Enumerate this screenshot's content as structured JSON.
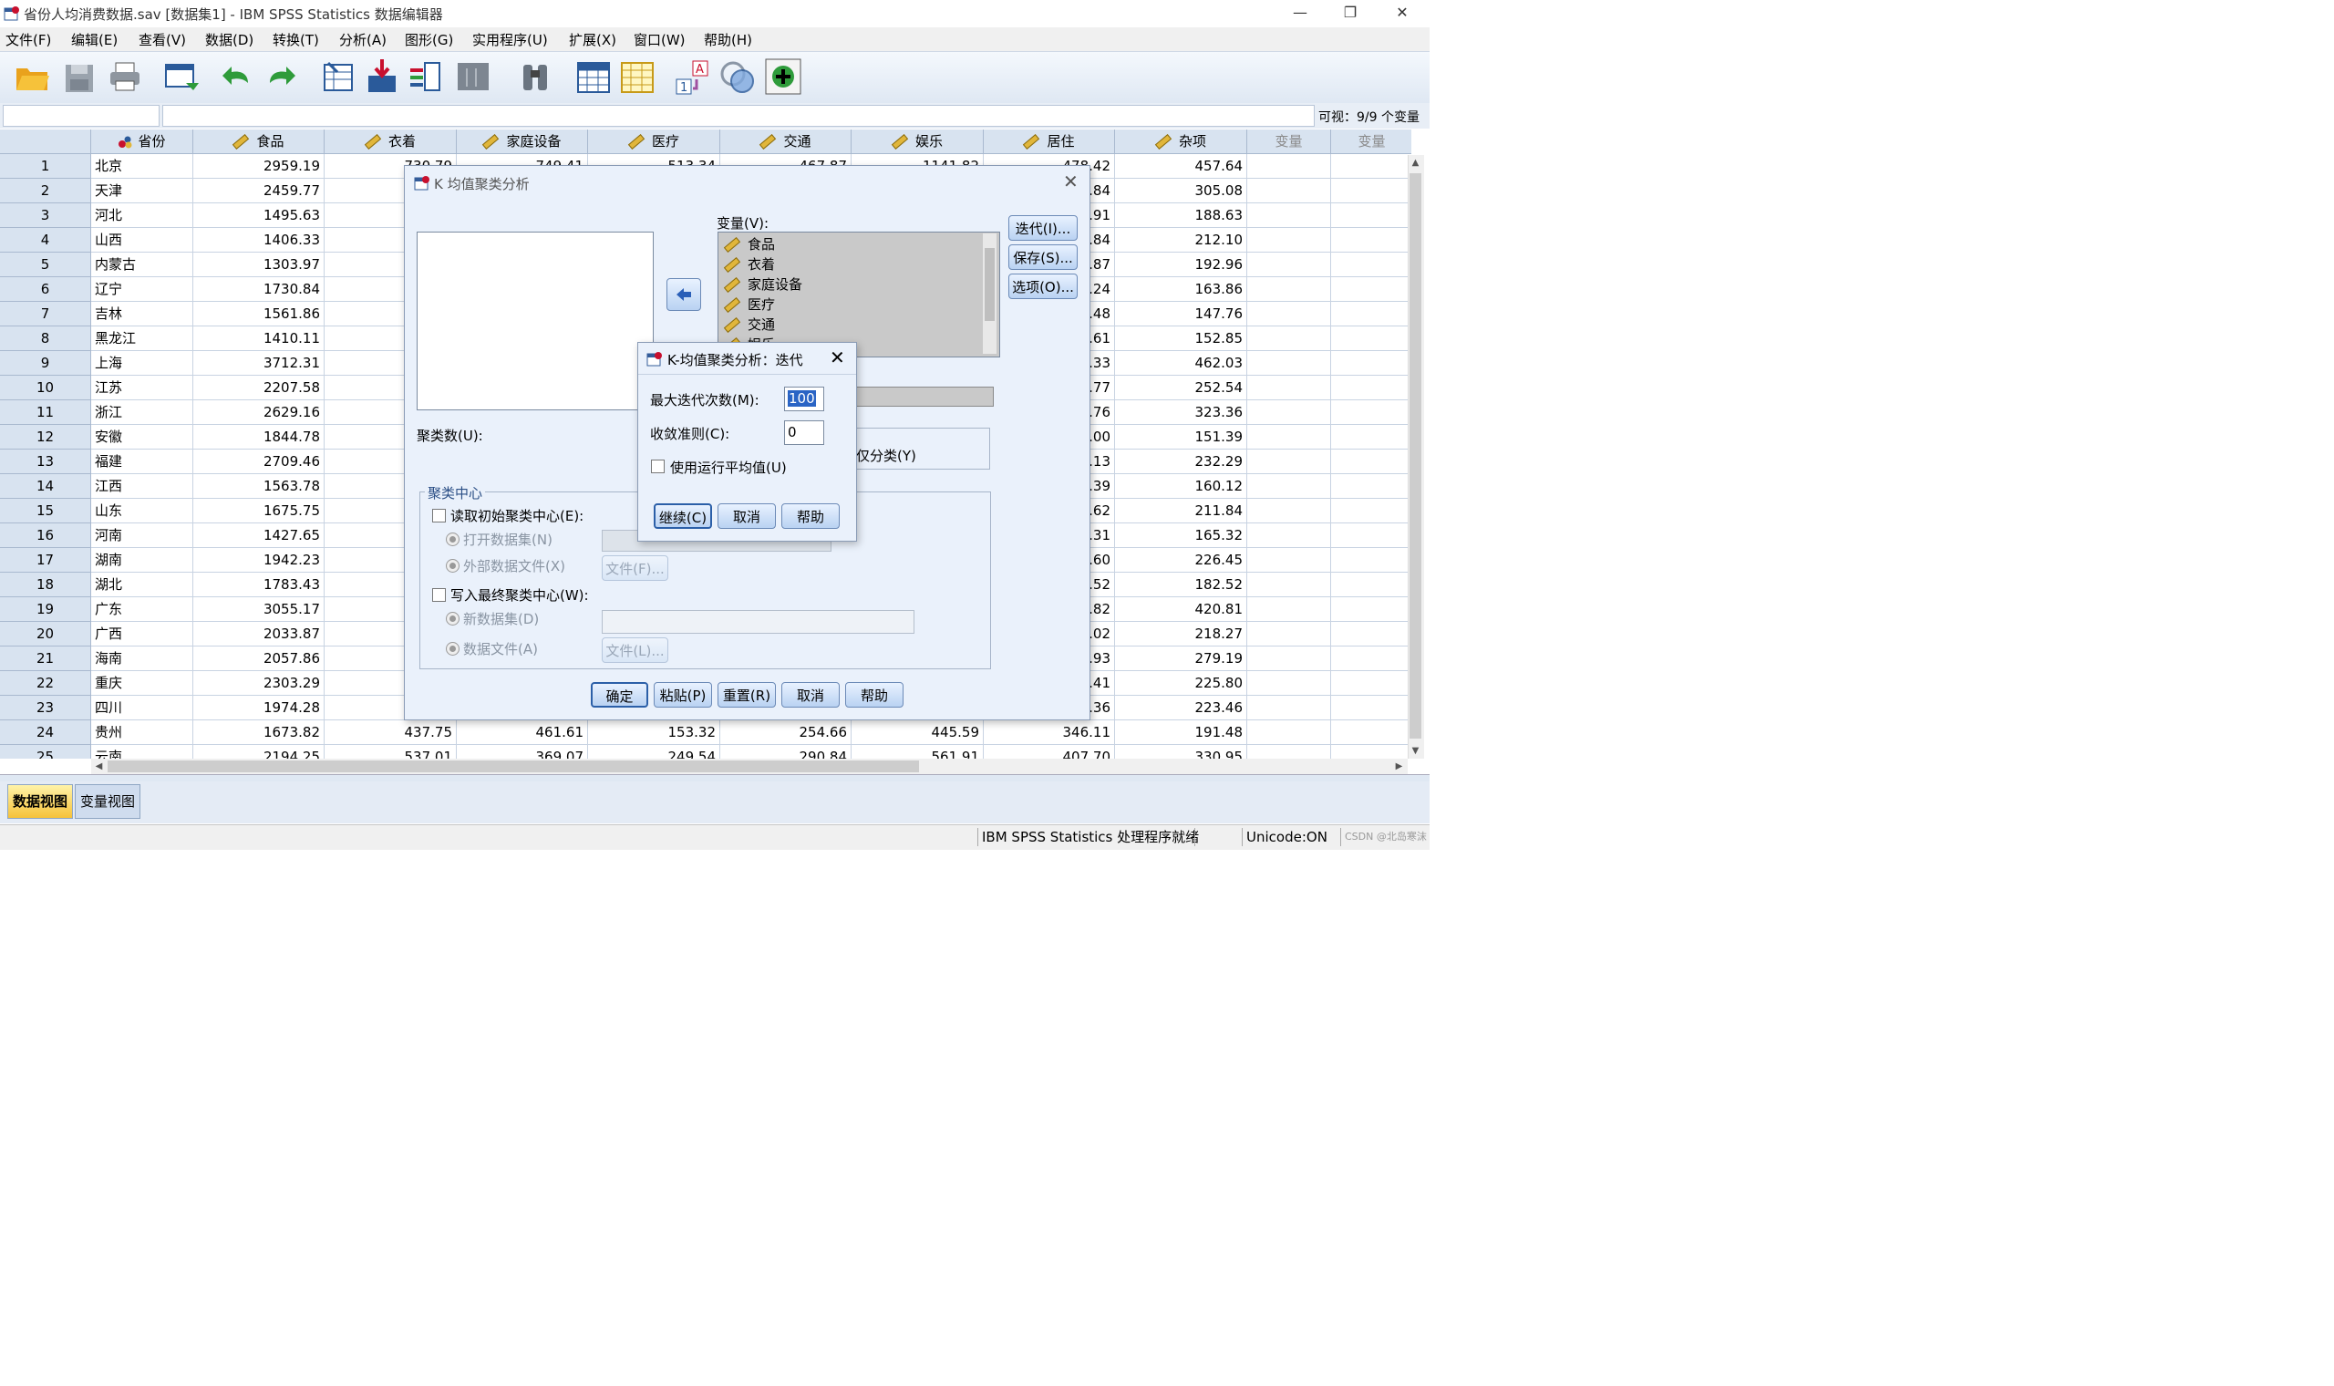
{
  "window": {
    "title": "省份人均消费数据.sav [数据集1] - IBM SPSS Statistics 数据编辑器",
    "minimize_label": "—",
    "restore_label": "❐",
    "close_label": "✕"
  },
  "menu": [
    "文件(F)",
    "编辑(E)",
    "查看(V)",
    "数据(D)",
    "转换(T)",
    "分析(A)",
    "图形(G)",
    "实用程序(U)",
    "扩展(X)",
    "窗口(W)",
    "帮助(H)"
  ],
  "toolbar_icons": [
    "open-file-icon",
    "save-icon",
    "print-icon",
    "recall-dialog-icon",
    "undo-icon",
    "redo-icon",
    "goto-case-icon",
    "goto-variable-icon",
    "variables-icon",
    "run-descriptives-icon",
    "find-icon",
    "insert-cases-icon",
    "insert-variable-icon",
    "split-file-icon",
    "weight-cases-icon",
    "select-cases-icon",
    "value-labels-icon",
    "use-variable-sets-icon"
  ],
  "cellbar": {
    "visible_count": "可视：9/9 个变量"
  },
  "grid": {
    "columns": [
      "省份",
      "食品",
      "衣着",
      "家庭设备",
      "医疗",
      "交通",
      "娱乐",
      "居住",
      "杂项",
      "变量",
      "变量"
    ],
    "rows": [
      [
        "1",
        "北京",
        "2959.19",
        "730.79",
        "749.41",
        "513.34",
        "467.87",
        "1141.82",
        "478.42",
        "457.64"
      ],
      [
        "2",
        "天津",
        "2459.77",
        "",
        "",
        "",
        "",
        "",
        "",
        "305.08"
      ],
      [
        "3",
        "河北",
        "1495.63",
        "",
        "",
        "",
        "",
        "",
        "",
        "188.63"
      ],
      [
        "4",
        "山西",
        "1406.33",
        "",
        "",
        "",
        "",
        "",
        "",
        "212.10"
      ],
      [
        "5",
        "内蒙古",
        "1303.97",
        "",
        "",
        "",
        "",
        "",
        "",
        "192.96"
      ],
      [
        "6",
        "辽宁",
        "1730.84",
        "",
        "",
        "",
        "",
        "",
        "",
        "163.86"
      ],
      [
        "7",
        "吉林",
        "1561.86",
        "",
        "",
        "",
        "",
        "",
        "",
        "147.76"
      ],
      [
        "8",
        "黑龙江",
        "1410.11",
        "",
        "",
        "",
        "",
        "",
        "",
        "152.85"
      ],
      [
        "9",
        "上海",
        "3712.31",
        "",
        "",
        "",
        "",
        "",
        "",
        "462.03"
      ],
      [
        "10",
        "江苏",
        "2207.58",
        "",
        "",
        "",
        "",
        "",
        "",
        "252.54"
      ],
      [
        "11",
        "浙江",
        "2629.16",
        "",
        "",
        "",
        "",
        "",
        "",
        "323.36"
      ],
      [
        "12",
        "安徽",
        "1844.78",
        "",
        "",
        "",
        "",
        "",
        "",
        "151.39"
      ],
      [
        "13",
        "福建",
        "2709.46",
        "",
        "",
        "",
        "",
        "",
        "",
        "232.29"
      ],
      [
        "14",
        "江西",
        "1563.78",
        "",
        "",
        "",
        "",
        "",
        "",
        "160.12"
      ],
      [
        "15",
        "山东",
        "1675.75",
        "",
        "",
        "",
        "",
        "",
        "",
        "211.84"
      ],
      [
        "16",
        "河南",
        "1427.65",
        "",
        "",
        "",
        "",
        "",
        "",
        "165.32"
      ],
      [
        "17",
        "湖南",
        "1942.23",
        "",
        "",
        "",
        "",
        "",
        "",
        "226.45"
      ],
      [
        "18",
        "湖北",
        "1783.43",
        "",
        "",
        "",
        "",
        "",
        "",
        "182.52"
      ],
      [
        "19",
        "广东",
        "3055.17",
        "",
        "",
        "",
        "",
        "",
        "",
        "420.81"
      ],
      [
        "20",
        "广西",
        "2033.87",
        "",
        "",
        "",
        "",
        "",
        "",
        "218.27"
      ],
      [
        "21",
        "海南",
        "2057.86",
        "",
        "",
        "",
        "",
        "",
        "",
        "279.19"
      ],
      [
        "22",
        "重庆",
        "2303.29",
        "",
        "",
        "",
        "",
        "",
        "",
        "225.80"
      ],
      [
        "23",
        "四川",
        "1974.28",
        "",
        "",
        "",
        "",
        "",
        "",
        "223.46"
      ],
      [
        "24",
        "贵州",
        "1673.82",
        "437.75",
        "461.61",
        "153.32",
        "254.66",
        "445.59",
        "346.11",
        "191.48"
      ],
      [
        "25",
        "云南",
        "2194.25",
        "537.01",
        "369.07",
        "249.54",
        "290.84",
        "561.91",
        "407.70",
        "330.95"
      ]
    ],
    "partial_juzhu": [
      ".42",
      ".84",
      ".91",
      ".84",
      ".87",
      ".24",
      ".48",
      ".61",
      ".33",
      ".77",
      ".76",
      ".00",
      ".13",
      ".39",
      ".62",
      ".31",
      ".60",
      ".52",
      ".82",
      ".02",
      ".93",
      ".41",
      ".36"
    ]
  },
  "kmeans_dialog": {
    "title": "K 均值聚类分析",
    "variables_label": "变量(V):",
    "variables": [
      "食品",
      "衣着",
      "家庭设备",
      "医疗",
      "交通",
      "娱乐"
    ],
    "clusters_label": "聚类数(U):",
    "classify_only_label": "仅分类(Y)",
    "iterate_button": "迭代(I)...",
    "save_button": "保存(S)...",
    "options_button": "选项(O)...",
    "centers_group": "聚类中心",
    "read_initial": "读取初始聚类中心(E):",
    "open_dataset": "打开数据集(N)",
    "external_file": "外部数据文件(X)",
    "file_button_1": "文件(F)...",
    "write_final": "写入最终聚类中心(W):",
    "new_dataset": "新数据集(D)",
    "data_file": "数据文件(A)",
    "file_button_2": "文件(L)...",
    "ok_button": "确定",
    "paste_button": "粘贴(P)",
    "reset_button": "重置(R)",
    "cancel_button": "取消",
    "help_button": "帮助"
  },
  "iterate_dialog": {
    "title": "K-均值聚类分析：迭代",
    "max_iter_label": "最大迭代次数(M):",
    "max_iter_value": "100",
    "convergence_label": "收敛准则(C):",
    "convergence_value": "0",
    "running_means_label": "使用运行平均值(U)",
    "continue_button": "继续(C)",
    "cancel_button": "取消",
    "help_button": "帮助"
  },
  "tabs": {
    "data_view": "数据视图",
    "variable_view": "变量视图"
  },
  "status": {
    "processor": "IBM SPSS Statistics 处理程序就绪",
    "unicode": "Unicode:ON",
    "watermark": "CSDN @北岛寒沫"
  },
  "colors": {
    "header_bg": "#d8e3f0",
    "accent": "#2b5fa8",
    "tab_active": "#f6c23a"
  }
}
